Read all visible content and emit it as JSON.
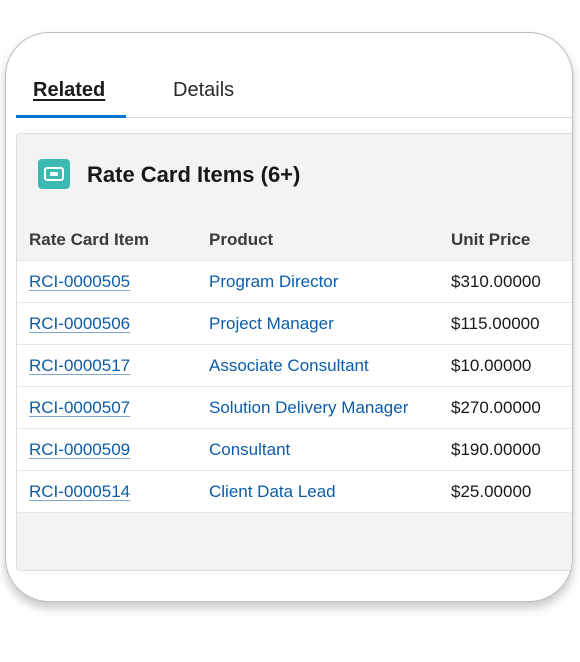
{
  "tabs": [
    {
      "label": "Related",
      "active": true
    },
    {
      "label": "Details",
      "active": false
    }
  ],
  "panel": {
    "icon": "rate-card-icon",
    "title": "Rate Card Items (6+)",
    "accent_color": "#3cb9b0"
  },
  "table": {
    "columns": [
      "Rate Card Item",
      "Product",
      "Unit Price"
    ],
    "rows": [
      {
        "item": "RCI-0000505",
        "product": "Program Director",
        "price": "$310.00000"
      },
      {
        "item": "RCI-0000506",
        "product": "Project Manager",
        "price": "$115.00000"
      },
      {
        "item": "RCI-0000517",
        "product": "Associate Consultant",
        "price": "$10.00000"
      },
      {
        "item": "RCI-0000507",
        "product": "Solution Delivery Manager",
        "price": "$270.00000"
      },
      {
        "item": "RCI-0000509",
        "product": "Consultant",
        "price": "$190.00000"
      },
      {
        "item": "RCI-0000514",
        "product": "Client Data Lead",
        "price": "$25.00000"
      }
    ]
  },
  "colors": {
    "link": "#0b5cab",
    "tab_indicator": "#0176d3"
  }
}
